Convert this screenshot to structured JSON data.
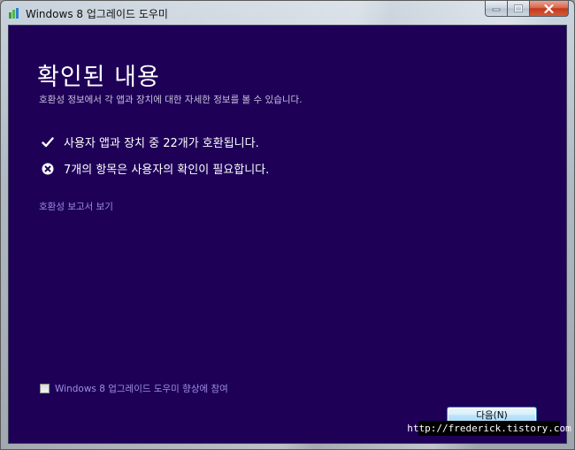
{
  "window": {
    "title": "Windows 8 업그레이드 도우미",
    "icon": "upgrade-assistant-app-icon"
  },
  "content": {
    "heading": "확인된 내용",
    "subheading": "호환성 정보에서 각 앱과 장치에 대한 자세한 정보를 볼 수 있습니다.",
    "results": [
      {
        "icon": "check-icon",
        "text": "사용자 앱과 장치 중 22개가 호환됩니다."
      },
      {
        "icon": "error-x-icon",
        "text": "7개의 항목은 사용자의 확인이 필요합니다."
      }
    ],
    "report_link": "호환성 보고서 보기",
    "participate_label": "Windows 8 업그레이드 도우미 향상에 참여",
    "next_button": "다음(N)"
  },
  "watermark": "http://frederick.tistory.com",
  "colors": {
    "background": "#1e0057",
    "link": "#9d8fe6",
    "text": "#ffffff"
  }
}
